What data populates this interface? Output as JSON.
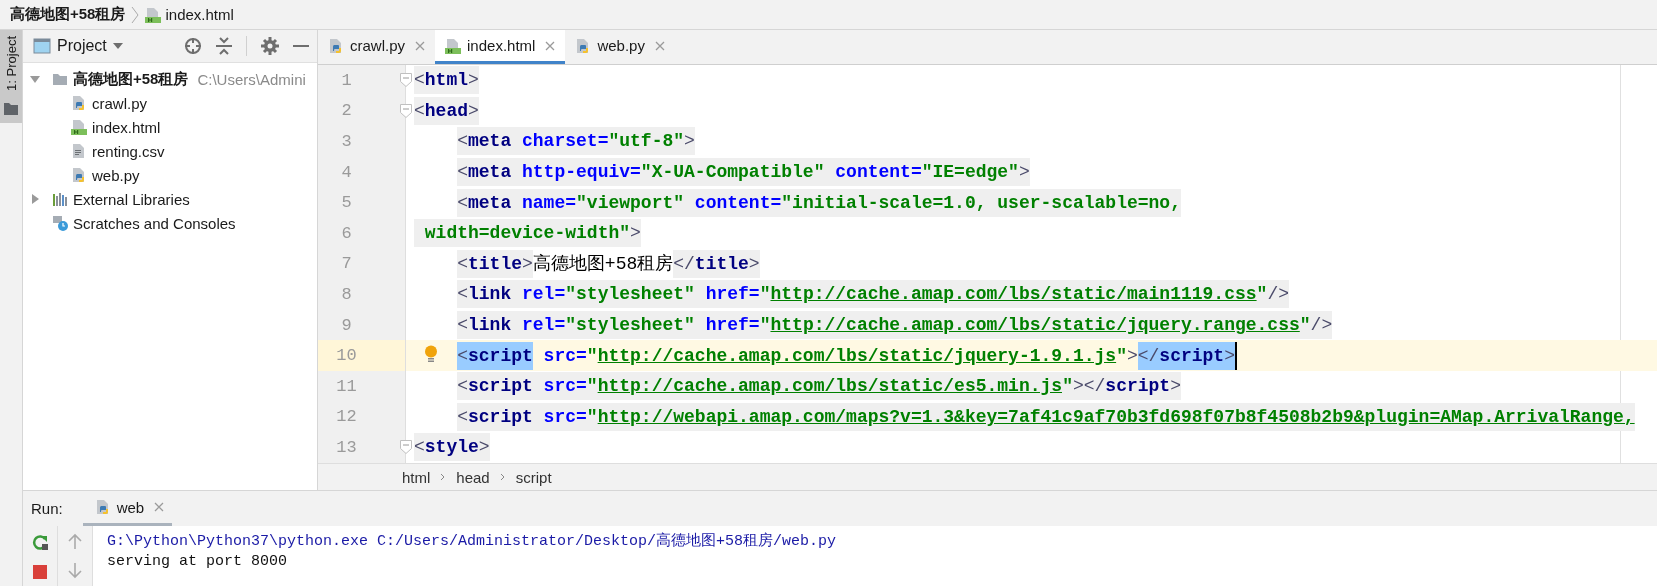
{
  "navigation_bar": {
    "crumbs": [
      {
        "kind": "project",
        "label": "高德地图+58租房"
      },
      {
        "kind": "html",
        "label": "index.html"
      }
    ]
  },
  "tool_strip": {
    "label": "1: Project"
  },
  "project_panel": {
    "title": "Project",
    "tree": [
      {
        "kind": "folder",
        "label": "高德地图+58租房",
        "hint": "C:\\Users\\Admini",
        "expanded": true,
        "children": [
          {
            "kind": "python",
            "label": "crawl.py"
          },
          {
            "kind": "html",
            "label": "index.html"
          },
          {
            "kind": "csv",
            "label": "renting.csv"
          },
          {
            "kind": "python",
            "label": "web.py"
          }
        ]
      },
      {
        "kind": "libraries",
        "label": "External Libraries",
        "expanded": false
      },
      {
        "kind": "scratches",
        "label": "Scratches and Consoles"
      }
    ]
  },
  "tabs": [
    {
      "kind": "python",
      "label": "crawl.py",
      "selected": false
    },
    {
      "kind": "html",
      "label": "index.html",
      "selected": true
    },
    {
      "kind": "python",
      "label": "web.py",
      "selected": false
    }
  ],
  "code_lines": [
    {
      "number": "1",
      "indented": false,
      "fold": true,
      "current": false,
      "bulb": false,
      "tokens": [
        {
          "kind": "punct",
          "text": "<"
        },
        {
          "kind": "tag",
          "text": "html"
        },
        {
          "kind": "punct",
          "text": ">"
        }
      ]
    },
    {
      "number": "2",
      "indented": false,
      "fold": true,
      "current": false,
      "bulb": false,
      "tokens": [
        {
          "kind": "punct",
          "text": "<"
        },
        {
          "kind": "tag",
          "text": "head"
        },
        {
          "kind": "punct",
          "text": ">"
        }
      ]
    },
    {
      "number": "3",
      "indented": true,
      "fold": false,
      "current": false,
      "bulb": false,
      "tokens": [
        {
          "kind": "punct",
          "text": "<"
        },
        {
          "kind": "tag",
          "text": "meta"
        },
        {
          "kind": "attr",
          "text": " charset="
        },
        {
          "kind": "value",
          "text": "\"utf-8\""
        },
        {
          "kind": "punct",
          "text": ">"
        }
      ]
    },
    {
      "number": "4",
      "indented": true,
      "fold": false,
      "current": false,
      "bulb": false,
      "tokens": [
        {
          "kind": "punct",
          "text": "<"
        },
        {
          "kind": "tag",
          "text": "meta"
        },
        {
          "kind": "attr",
          "text": " http-equiv="
        },
        {
          "kind": "value",
          "text": "\"X-UA-Compatible\""
        },
        {
          "kind": "attr",
          "text": " content="
        },
        {
          "kind": "value",
          "text": "\"IE=edge\""
        },
        {
          "kind": "punct",
          "text": ">"
        }
      ]
    },
    {
      "number": "5",
      "indented": true,
      "fold": false,
      "current": false,
      "bulb": false,
      "tokens": [
        {
          "kind": "punct",
          "text": "<"
        },
        {
          "kind": "tag",
          "text": "meta"
        },
        {
          "kind": "attr",
          "text": " name="
        },
        {
          "kind": "value",
          "text": "\"viewport\""
        },
        {
          "kind": "attr",
          "text": " content="
        },
        {
          "kind": "value",
          "text": "\"initial-scale=1.0, user-scalable=no,"
        }
      ]
    },
    {
      "number": "6",
      "indented": false,
      "fold": false,
      "current": false,
      "bulb": false,
      "tokens": [
        {
          "kind": "value",
          "text": " width=device-width\""
        },
        {
          "kind": "punct",
          "text": ">"
        }
      ]
    },
    {
      "number": "7",
      "indented": true,
      "fold": false,
      "current": false,
      "bulb": false,
      "tokens": [
        {
          "kind": "punct",
          "text": "<"
        },
        {
          "kind": "tag",
          "text": "title"
        },
        {
          "kind": "punct",
          "text": ">"
        },
        {
          "kind": "text",
          "text": "高德地图+58租房"
        },
        {
          "kind": "punct",
          "text": "</"
        },
        {
          "kind": "tag",
          "text": "title"
        },
        {
          "kind": "punct",
          "text": ">"
        }
      ]
    },
    {
      "number": "8",
      "indented": true,
      "fold": false,
      "current": false,
      "bulb": false,
      "tokens": [
        {
          "kind": "punct",
          "text": "<"
        },
        {
          "kind": "tag",
          "text": "link"
        },
        {
          "kind": "attr",
          "text": " rel="
        },
        {
          "kind": "value",
          "text": "\"stylesheet\""
        },
        {
          "kind": "attr",
          "text": " href="
        },
        {
          "kind": "value",
          "text": "\""
        },
        {
          "kind": "link",
          "text": "http://cache.amap.com/lbs/static/main1119.css"
        },
        {
          "kind": "value",
          "text": "\""
        },
        {
          "kind": "punct",
          "text": "/>"
        }
      ]
    },
    {
      "number": "9",
      "indented": true,
      "fold": false,
      "current": false,
      "bulb": false,
      "tokens": [
        {
          "kind": "punct",
          "text": "<"
        },
        {
          "kind": "tag",
          "text": "link"
        },
        {
          "kind": "attr",
          "text": " rel="
        },
        {
          "kind": "value",
          "text": "\"stylesheet\""
        },
        {
          "kind": "attr",
          "text": " href="
        },
        {
          "kind": "value",
          "text": "\""
        },
        {
          "kind": "link",
          "text": "http://cache.amap.com/lbs/static/jquery.range.css"
        },
        {
          "kind": "value",
          "text": "\""
        },
        {
          "kind": "punct",
          "text": "/>"
        }
      ]
    },
    {
      "number": "10",
      "indented": true,
      "fold": false,
      "current": true,
      "bulb": true,
      "tokens": [
        {
          "kind": "punct",
          "text": "<",
          "highlighted": true
        },
        {
          "kind": "tag",
          "text": "script",
          "highlighted": true
        },
        {
          "kind": "attr",
          "text": " src="
        },
        {
          "kind": "value",
          "text": "\""
        },
        {
          "kind": "link",
          "text": "http://cache.amap.com/lbs/static/jquery-1.9.1.js"
        },
        {
          "kind": "value",
          "text": "\""
        },
        {
          "kind": "punct",
          "text": ">"
        },
        {
          "kind": "punct",
          "text": "</",
          "highlighted": true
        },
        {
          "kind": "tag",
          "text": "script",
          "highlighted": true
        },
        {
          "kind": "punct",
          "text": ">",
          "highlighted": true,
          "caret_after": true
        }
      ]
    },
    {
      "number": "11",
      "indented": true,
      "fold": false,
      "current": false,
      "bulb": false,
      "tokens": [
        {
          "kind": "punct",
          "text": "<"
        },
        {
          "kind": "tag",
          "text": "script"
        },
        {
          "kind": "attr",
          "text": " src="
        },
        {
          "kind": "value",
          "text": "\""
        },
        {
          "kind": "link",
          "text": "http://cache.amap.com/lbs/static/es5.min.js"
        },
        {
          "kind": "value",
          "text": "\""
        },
        {
          "kind": "punct",
          "text": "></"
        },
        {
          "kind": "tag",
          "text": "script"
        },
        {
          "kind": "punct",
          "text": ">"
        }
      ]
    },
    {
      "number": "12",
      "indented": true,
      "fold": false,
      "current": false,
      "bulb": false,
      "tokens": [
        {
          "kind": "punct",
          "text": "<"
        },
        {
          "kind": "tag",
          "text": "script"
        },
        {
          "kind": "attr",
          "text": " src="
        },
        {
          "kind": "value",
          "text": "\""
        },
        {
          "kind": "link",
          "text": "http://webapi.amap.com/maps?v=1.3&key=7af41c9af70b3fd698f07b8f4508b2b9&plugin=AMap.ArrivalRange,"
        }
      ]
    },
    {
      "number": "13",
      "indented": false,
      "fold": true,
      "current": false,
      "bulb": false,
      "tokens": [
        {
          "kind": "punct",
          "text": "<"
        },
        {
          "kind": "tag",
          "text": "style"
        },
        {
          "kind": "punct",
          "text": ">"
        }
      ]
    }
  ],
  "editor_breadcrumb": [
    "html",
    "head",
    "script"
  ],
  "run_panel": {
    "label": "Run:",
    "tabs": [
      {
        "kind": "python",
        "label": "web",
        "selected": true
      }
    ],
    "output": [
      {
        "kind": "command",
        "text": "G:\\Python\\Python37\\python.exe C:/Users/Administrator/Desktop/高德地图+58租房/web.py"
      },
      {
        "kind": "stdout",
        "text": "serving at port 8000"
      }
    ]
  }
}
